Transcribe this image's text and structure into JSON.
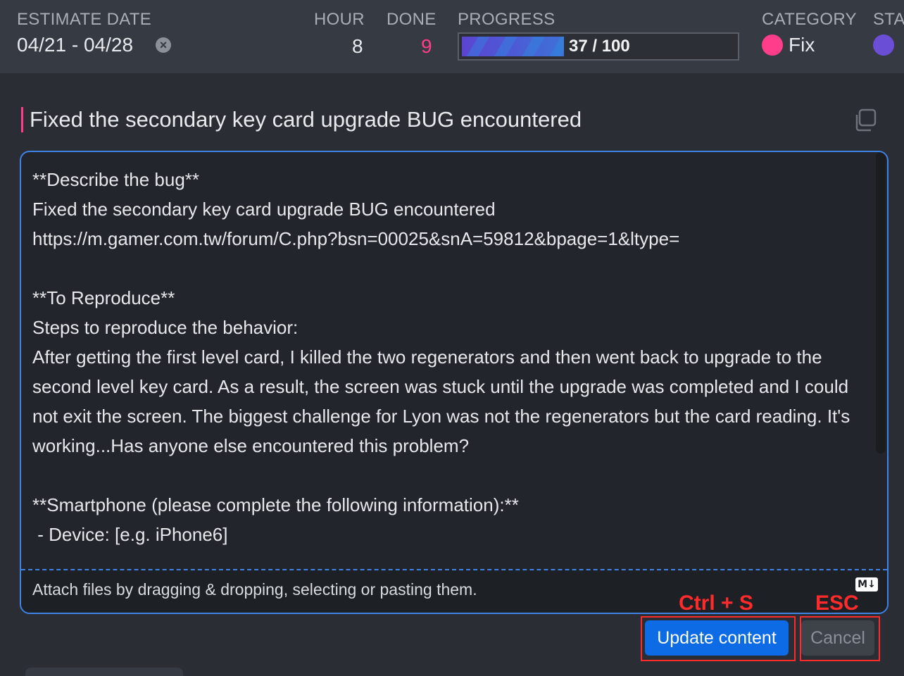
{
  "header": {
    "estimate_date_label": "ESTIMATE DATE",
    "estimate_date_value": "04/21 - 04/28",
    "hour_label": "HOUR",
    "hour_value": "8",
    "done_label": "DONE",
    "done_value": "9",
    "progress_label": "PROGRESS",
    "progress_text": "37 / 100",
    "progress_fraction": 0.37,
    "category_label": "CATEGORY",
    "category_value": "Fix",
    "category_color": "#ff3d8b",
    "status_label": "STA",
    "status_color": "#6a4fd6"
  },
  "task": {
    "title": "Fixed the secondary key card upgrade BUG encountered"
  },
  "editor": {
    "content": "**Describe the bug**\nFixed the secondary key card upgrade BUG encountered\nhttps://m.gamer.com.tw/forum/C.php?bsn=00025&snA=59812&bpage=1&ltype=\n\n**To Reproduce**\nSteps to reproduce the behavior:\nAfter getting the first level card, I killed the two regenerators and then went back to upgrade to the second level key card. As a result, the screen was stuck until the upgrade was completed and I could not exit the screen. The biggest challenge for Lyon was not the regenerators but the card reading. It's working...Has anyone else encountered this problem?\n\n**Smartphone (please complete the following information):**\n - Device: [e.g. iPhone6]",
    "attach_hint": "Attach files by dragging & dropping, selecting or pasting them.",
    "markdown_badge": "M↓"
  },
  "actions": {
    "update_label": "Update content",
    "cancel_label": "Cancel",
    "update_shortcut": "Ctrl + S",
    "cancel_shortcut": "ESC"
  },
  "colors": {
    "accent": "#0d6be6",
    "focus_border": "#3f83e6",
    "done": "#ff3d8b",
    "annotation": "#ff2a2a"
  }
}
